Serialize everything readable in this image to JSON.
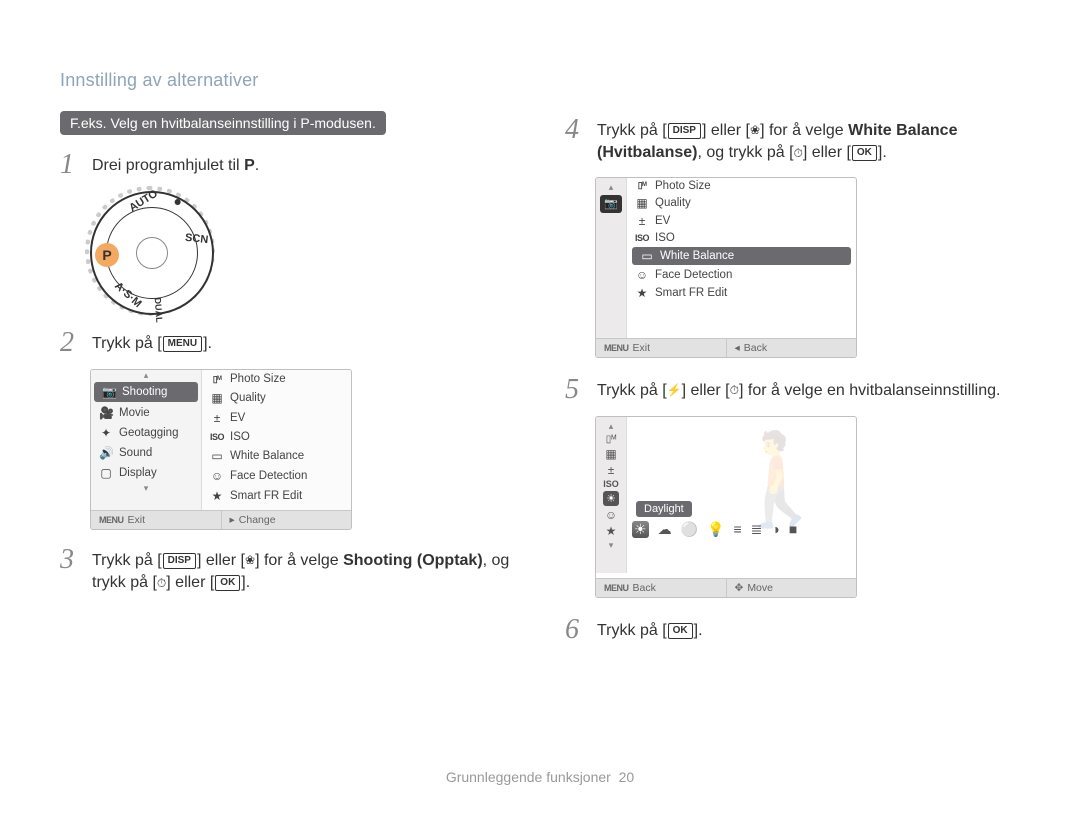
{
  "header": {
    "title": "Innstilling av alternativer"
  },
  "banner": "F.eks. Velg en hvitbalanseinnstilling i P-modusen.",
  "buttons": {
    "menu": "MENU",
    "disp": "DISP",
    "ok": "OK",
    "menu_small": "MENU"
  },
  "glyphs": {
    "macro": "❀",
    "flash": "⚡",
    "timer": "⏱"
  },
  "steps": {
    "s1_pre": "Drei programhjulet til ",
    "s1_mode": "P",
    "s1_post": ".",
    "s2_pre": "Trykk på [",
    "s2_post": "].",
    "s3_a": "Trykk på [",
    "s3_b": "] eller [",
    "s3_c": "] for å velge ",
    "s3_bold": "Shooting (Opptak)",
    "s3_d": ", og trykk på [",
    "s3_e": "] eller [",
    "s3_f": "].",
    "s4_a": "Trykk på [",
    "s4_b": "] eller [",
    "s4_c": "] for å velge ",
    "s4_bold1": "White Balance (Hvitbalanse)",
    "s4_d": ", og trykk på [",
    "s4_e": "] eller [",
    "s4_f": "].",
    "s5": "Trykk på [",
    "s5_b": "] eller [",
    "s5_c": "] for å velge en hvitbalanseinnstilling.",
    "s6_a": "Trykk på [",
    "s6_b": "]."
  },
  "dial": {
    "labels": {
      "auto": "AUTO",
      "p": "P",
      "asm": "A·S·M",
      "dual": "DUAL",
      "camera": "●",
      "scn": "SCN"
    }
  },
  "screen_menu": {
    "left": [
      {
        "icon": "📷",
        "label": "Shooting",
        "selected": true
      },
      {
        "icon": "🎥",
        "label": "Movie"
      },
      {
        "icon": "✦",
        "label": "Geotagging"
      },
      {
        "icon": "🔊",
        "label": "Sound"
      },
      {
        "icon": "▢",
        "label": "Display"
      }
    ],
    "right": [
      {
        "icon": "▯ᴹ",
        "label": "Photo Size"
      },
      {
        "icon": "▦",
        "label": "Quality"
      },
      {
        "icon": "±",
        "label": "EV"
      },
      {
        "icon": "ISO",
        "label": "ISO"
      },
      {
        "icon": "▭",
        "label": "White Balance"
      },
      {
        "icon": "☺",
        "label": "Face Detection"
      },
      {
        "icon": "★",
        "label": "Smart FR Edit"
      }
    ],
    "foot_left": "Exit",
    "foot_right": "Change"
  },
  "screen_wb": {
    "opts": [
      {
        "icon": "▯ᴹ",
        "label": "Photo Size"
      },
      {
        "icon": "▦",
        "label": "Quality"
      },
      {
        "icon": "±",
        "label": "EV"
      },
      {
        "icon": "ISO",
        "label": "ISO"
      },
      {
        "icon": "▭",
        "label": "White Balance",
        "selected": true
      },
      {
        "icon": "☺",
        "label": "Face Detection"
      },
      {
        "icon": "★",
        "label": "Smart FR Edit"
      }
    ],
    "foot_left": "Exit",
    "foot_right": "Back"
  },
  "screen_daylight": {
    "label": "Daylight",
    "foot_left": "Back",
    "foot_right": "Move",
    "wb_icons": [
      "☀",
      "☁",
      "⚪",
      "💡",
      "≡",
      "≣",
      "◑",
      "■"
    ]
  },
  "footer": {
    "text": "Grunnleggende funksjoner",
    "page": "20"
  }
}
